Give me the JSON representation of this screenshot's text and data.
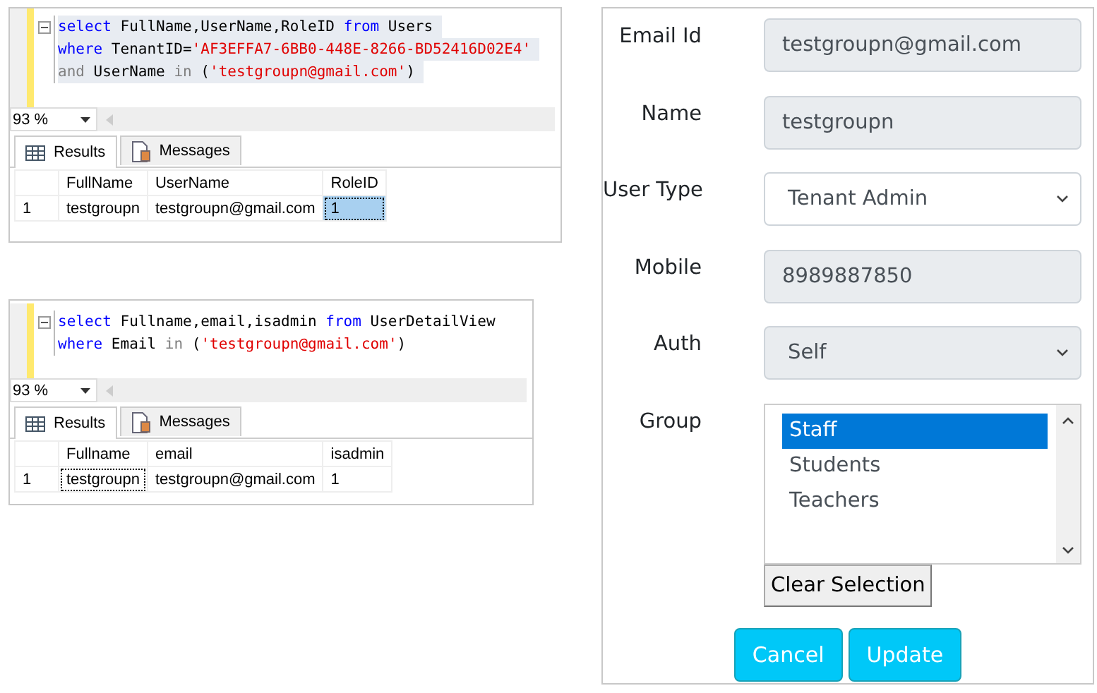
{
  "query_panels": [
    {
      "code_selected": true,
      "code_lines": [
        [
          {
            "kind": "keyword",
            "text": "select"
          },
          {
            "kind": "plain",
            "text": " FullName,UserName,RoleID "
          },
          {
            "kind": "keyword",
            "text": "from"
          },
          {
            "kind": "plain",
            "text": " Users"
          }
        ],
        [
          {
            "kind": "keyword",
            "text": "where"
          },
          {
            "kind": "plain",
            "text": " TenantID="
          },
          {
            "kind": "string",
            "text": "'AF3EFFA7-6BB0-448E-8266-BD52416D02E4'"
          }
        ],
        [
          {
            "kind": "operator",
            "text": "and"
          },
          {
            "kind": "plain",
            "text": " UserName "
          },
          {
            "kind": "operator",
            "text": "in"
          },
          {
            "kind": "plain",
            "text": " ("
          },
          {
            "kind": "string",
            "text": "'testgroupn@gmail.com'"
          },
          {
            "kind": "plain",
            "text": ")"
          }
        ]
      ],
      "zoom": "93 %",
      "tabs": [
        {
          "label": "Results",
          "selected": true
        },
        {
          "label": "Messages",
          "selected": false
        }
      ],
      "columns": [
        "FullName",
        "UserName",
        "RoleID"
      ],
      "rows": [
        {
          "number": "1",
          "cells": [
            {
              "text": "testgroupn",
              "selected": false,
              "focused": false
            },
            {
              "text": "testgroupn@gmail.com",
              "selected": false,
              "focused": false
            },
            {
              "text": "1",
              "selected": true,
              "focused": true
            }
          ]
        }
      ]
    },
    {
      "code_selected": false,
      "code_lines": [
        [
          {
            "kind": "keyword",
            "text": "select"
          },
          {
            "kind": "plain",
            "text": " Fullname,email,isadmin "
          },
          {
            "kind": "keyword",
            "text": "from"
          },
          {
            "kind": "plain",
            "text": " UserDetailView"
          }
        ],
        [
          {
            "kind": "keyword",
            "text": "where"
          },
          {
            "kind": "plain",
            "text": " Email "
          },
          {
            "kind": "operator",
            "text": "in"
          },
          {
            "kind": "plain",
            "text": " ("
          },
          {
            "kind": "string",
            "text": "'testgroupn@gmail.com'"
          },
          {
            "kind": "plain",
            "text": ")"
          }
        ]
      ],
      "zoom": "93 %",
      "tabs": [
        {
          "label": "Results",
          "selected": true
        },
        {
          "label": "Messages",
          "selected": false
        }
      ],
      "columns": [
        "Fullname",
        "email",
        "isadmin"
      ],
      "rows": [
        {
          "number": "1",
          "cells": [
            {
              "text": "testgroupn",
              "selected": false,
              "focused": true
            },
            {
              "text": "testgroupn@gmail.com",
              "selected": false,
              "focused": false
            },
            {
              "text": "1",
              "selected": false,
              "focused": false
            }
          ]
        }
      ]
    }
  ],
  "form": {
    "fields": [
      {
        "label": "Email Id",
        "kind": "input",
        "value": "testgroupn@gmail.com",
        "disabled": true
      },
      {
        "label": "Name",
        "kind": "input",
        "value": "testgroupn",
        "disabled": true
      },
      {
        "label": "User Type",
        "kind": "select",
        "value": "Tenant Admin",
        "disabled": false
      },
      {
        "label": "Mobile",
        "kind": "input",
        "value": "8989887850",
        "disabled": true
      },
      {
        "label": "Auth",
        "kind": "select",
        "value": "Self",
        "disabled": true
      },
      {
        "label": "Group",
        "kind": "listbox",
        "options": [
          {
            "text": "Staff",
            "selected": true
          },
          {
            "text": "Students",
            "selected": false
          },
          {
            "text": "Teachers",
            "selected": false
          }
        ],
        "button": "Clear Selection"
      }
    ],
    "buttons": [
      "Cancel",
      "Update"
    ]
  }
}
